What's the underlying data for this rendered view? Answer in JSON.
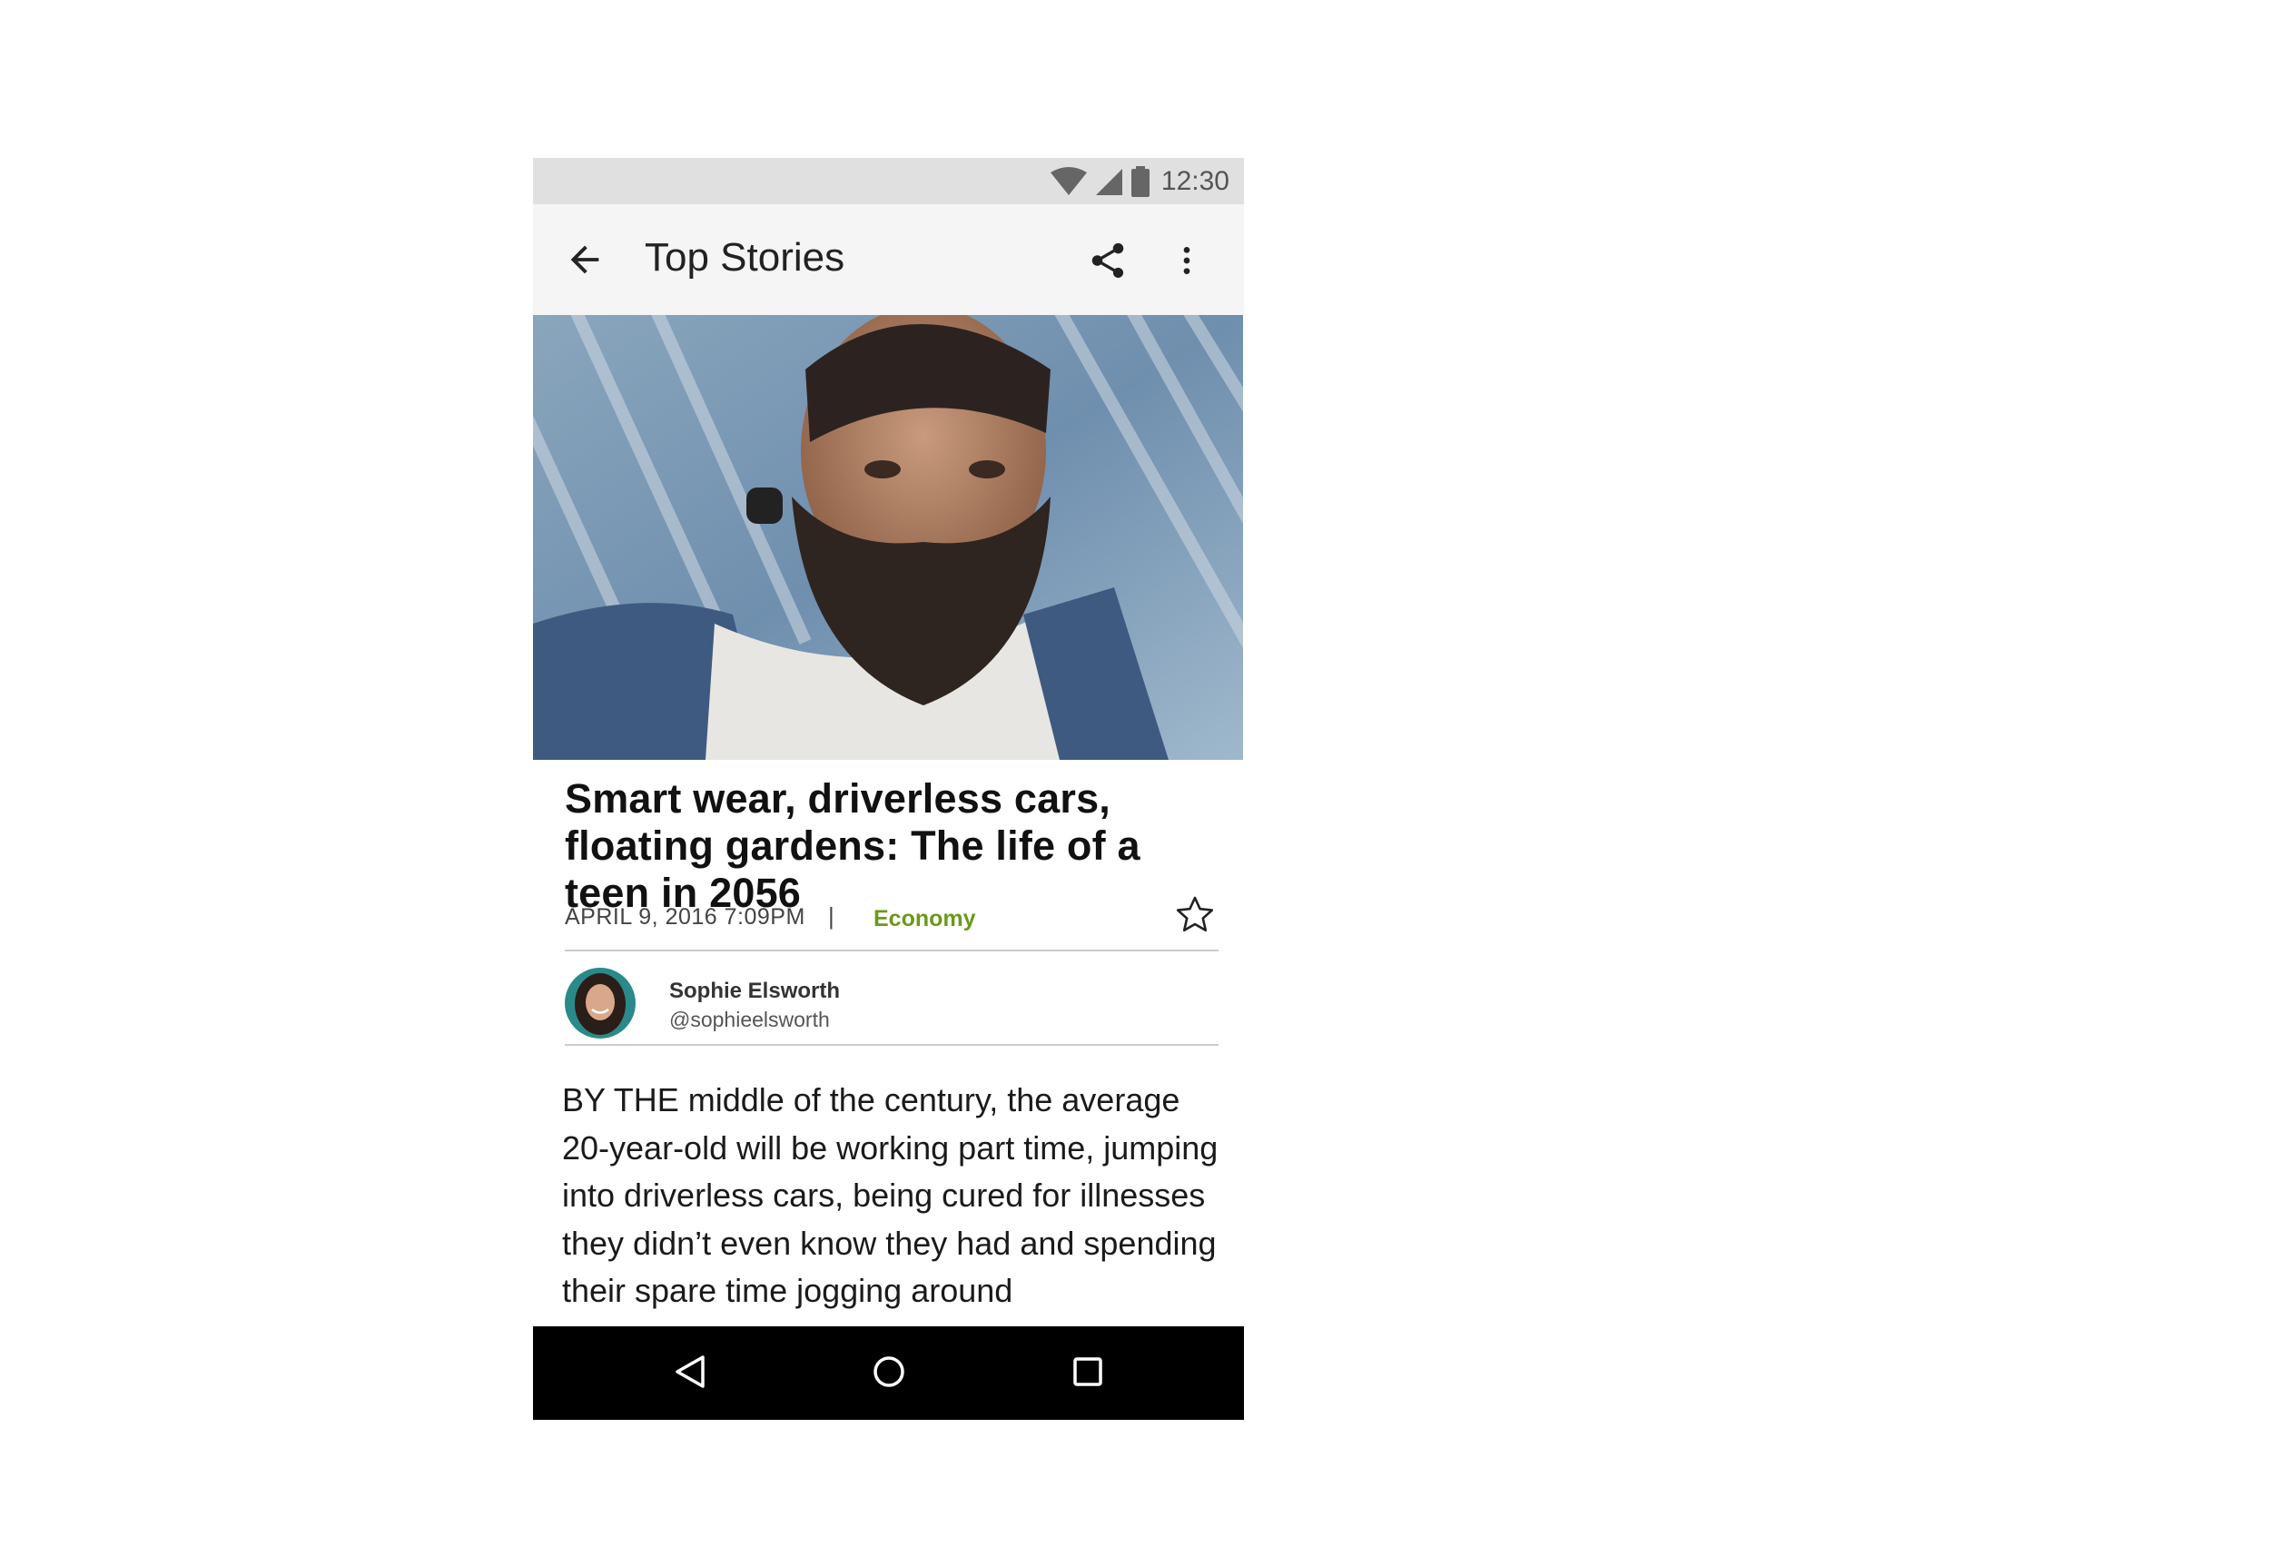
{
  "status_bar": {
    "time": "12:30",
    "icons": [
      "wifi-icon",
      "cell-signal-icon",
      "battery-icon"
    ]
  },
  "app_bar": {
    "title": "Top Stories",
    "icons": [
      "back-arrow-icon",
      "share-icon",
      "more-vert-icon"
    ]
  },
  "article": {
    "headline": "Smart wear, driverless cars, floating gardens: The life of a teen in 2056",
    "date": "APRIL 9, 2016  7:09PM",
    "separator": "|",
    "category": "Economy",
    "body": "BY THE middle of the century, the average 20-year-old will be working part time, jumping into driverless cars, being cured for illnesses they didn’t even know they had and spending their spare time jogging around"
  },
  "author": {
    "name": "Sophie Elsworth",
    "handle": "@sophieelsworth"
  },
  "colors": {
    "accent": "#6a9a1a",
    "app_bar": "#f5f5f5",
    "status_bar": "#e0e0e0",
    "nav_bar": "#000000"
  },
  "nav_bar": {
    "icons": [
      "nav-back-icon",
      "nav-home-icon",
      "nav-recents-icon"
    ]
  }
}
